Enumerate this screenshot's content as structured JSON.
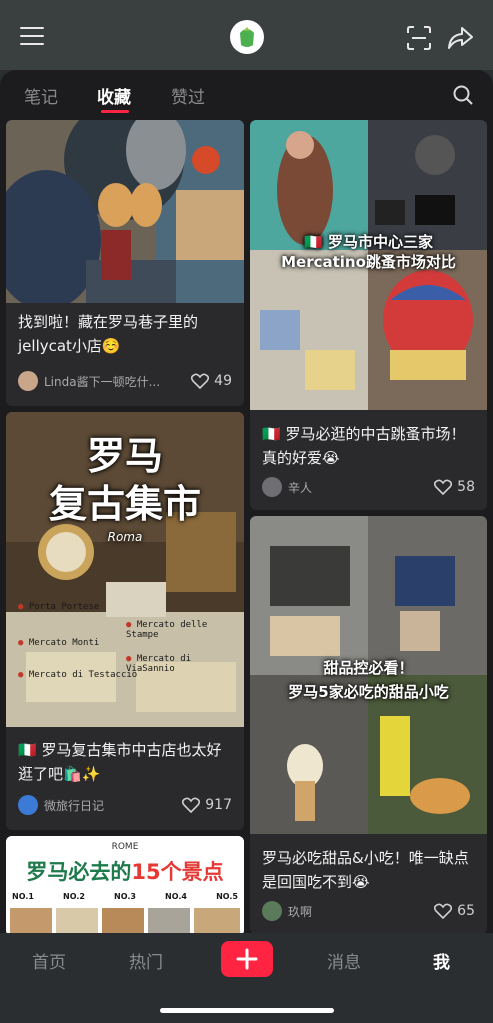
{
  "tabs": [
    "笔记",
    "收藏",
    "赞过"
  ],
  "active_tab": "收藏",
  "cards": [
    {
      "title": "找到啦！藏在罗马巷子里的jellycat小店☺️",
      "author": "Linda酱下一顿吃什...",
      "likes": "49"
    },
    {
      "overlay": [
        "🇮🇹 罗马市中心三家",
        "Mercatino跳蚤市场对比"
      ],
      "title": "🇮🇹 罗马必逛的中古跳蚤市场！真的好爱😭",
      "author": "辛人",
      "likes": "58"
    },
    {
      "overlay_big": [
        "罗马",
        "复古集市"
      ],
      "overlay_sub": "Roma",
      "map_labels": [
        "Porta Portese",
        "Mercato delle Stampe",
        "Mercato Monti",
        "Mercato di ViaSannio",
        "Mercato di Testaccio"
      ],
      "title": "🇮🇹 罗马复古集市中古店也太好逛了吧🛍️✨",
      "author": "微旅行日记",
      "likes": "917"
    },
    {
      "overlay": [
        "甜品控必看！",
        "罗马5家必吃的甜品小吃"
      ],
      "title": "罗马必吃甜品&小吃！唯一缺点是回国吃不到😭",
      "author": "玖啊",
      "likes": "65"
    },
    {
      "header": "ROME",
      "overlay_prefix": "罗马必去的",
      "overlay_highlight": "15个景点",
      "numbers": [
        "NO.1",
        "NO.2",
        "NO.3",
        "NO.4",
        "NO.5"
      ]
    }
  ],
  "bottom_nav": {
    "home": "首页",
    "hot": "热门",
    "messages": "消息",
    "me": "我"
  },
  "colors": {
    "accent": "#ff2442",
    "panel": "#1c1c1e",
    "card": "#2a2a2c"
  }
}
